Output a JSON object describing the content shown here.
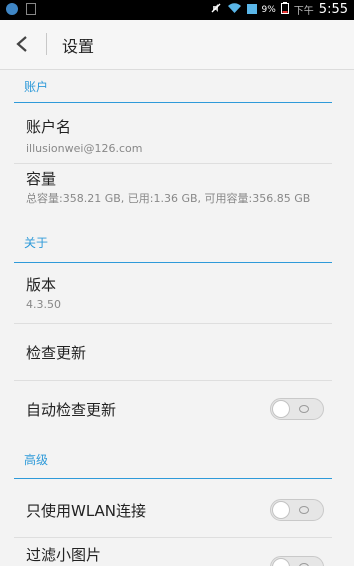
{
  "statusbar": {
    "battery": "9%",
    "ampm": "下午",
    "time": "5:55",
    "icons": [
      "app-icon",
      "image-icon",
      "mute-icon",
      "wifi-icon",
      "signal-icon",
      "battery-icon"
    ]
  },
  "titlebar": {
    "title": "设置"
  },
  "sections": {
    "account": {
      "header": "账户",
      "account_name_title": "账户名",
      "account_name_value": "illusionwei@126.com",
      "capacity_title": "容量",
      "capacity_value": "总容量:358.21 GB, 已用:1.36 GB, 可用容量:356.85 GB"
    },
    "about": {
      "header": "关于",
      "version_title": "版本",
      "version_value": "4.3.50",
      "check_update": "检查更新",
      "auto_check_update": "自动检查更新"
    },
    "advanced": {
      "header": "高级",
      "wlan_only": "只使用WLAN连接",
      "filter_small_images": "过滤小图片"
    }
  },
  "toggles": {
    "auto_check_update": false,
    "wlan_only": false,
    "filter_small_images": false
  },
  "colors": {
    "accent": "#2e9ad9",
    "background": "#f3f3f3",
    "statusbar": "#000000"
  }
}
